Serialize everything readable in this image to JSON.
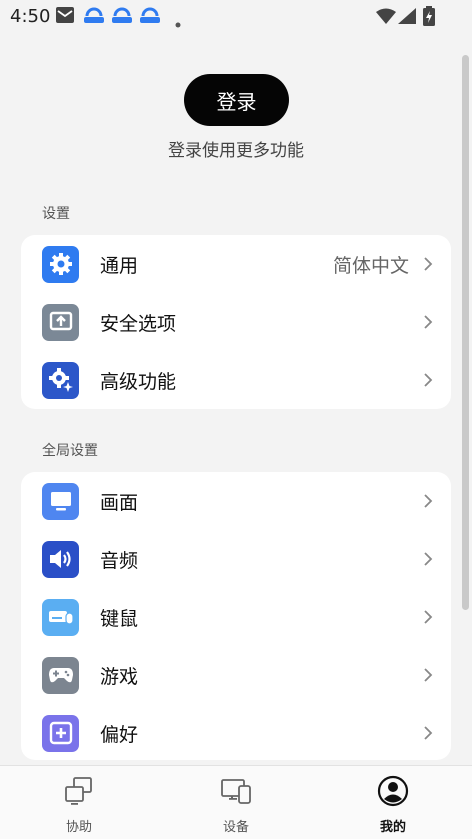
{
  "status_bar": {
    "time": "4:50"
  },
  "login": {
    "button_label": "登录",
    "hint": "登录使用更多功能"
  },
  "settings_section": {
    "title": "设置",
    "items": [
      {
        "label": "通用",
        "value": "简体中文",
        "icon": "gear-icon",
        "color": "#2f7bf0"
      },
      {
        "label": "安全选项",
        "value": "",
        "icon": "upload-screen-icon",
        "color": "#7b8896"
      },
      {
        "label": "高级功能",
        "value": "",
        "icon": "gear-sparkle-icon",
        "color": "#2c57c9"
      }
    ]
  },
  "global_section": {
    "title": "全局设置",
    "items": [
      {
        "label": "画面",
        "icon": "monitor-icon",
        "color": "#4f86f0"
      },
      {
        "label": "音频",
        "icon": "speaker-icon",
        "color": "#2a4fc7"
      },
      {
        "label": "键鼠",
        "icon": "keyboard-mouse-icon",
        "color": "#5aaef2"
      },
      {
        "label": "游戏",
        "icon": "gamepad-icon",
        "color": "#7c8590"
      },
      {
        "label": "偏好",
        "icon": "plus-square-icon",
        "color": "#7a73ea"
      }
    ]
  },
  "tab_bar": {
    "tabs": [
      {
        "label": "协助",
        "icon": "assist-icon",
        "active": false
      },
      {
        "label": "设备",
        "icon": "devices-icon",
        "active": false
      },
      {
        "label": "我的",
        "icon": "profile-icon",
        "active": true
      }
    ]
  }
}
